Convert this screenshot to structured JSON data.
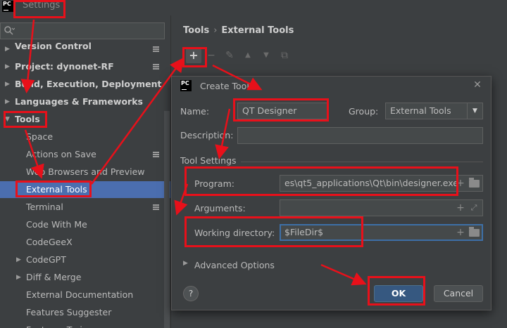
{
  "window": {
    "title": "Settings",
    "logo": "PC"
  },
  "search": {
    "placeholder": ""
  },
  "sidebar": {
    "items": [
      {
        "label": "Version Control"
      },
      {
        "label": "Project: dynonet-RF"
      },
      {
        "label": "Build, Execution, Deployment"
      },
      {
        "label": "Languages & Frameworks"
      },
      {
        "label": "Tools"
      },
      {
        "label": "Space"
      },
      {
        "label": "Actions on Save"
      },
      {
        "label": "Web Browsers and Preview"
      },
      {
        "label": "External Tools"
      },
      {
        "label": "Terminal"
      },
      {
        "label": "Code With Me"
      },
      {
        "label": "CodeGeeX"
      },
      {
        "label": "CodeGPT"
      },
      {
        "label": "Diff & Merge"
      },
      {
        "label": "External Documentation"
      },
      {
        "label": "Features Suggester"
      },
      {
        "label": "Features Trainer"
      }
    ]
  },
  "main": {
    "breadcrumb": {
      "root": "Tools",
      "separator": "›",
      "current": "External Tools"
    },
    "toolbar": {
      "add": "+",
      "remove": "−",
      "edit": "✎",
      "up": "▲",
      "down": "▼",
      "copy": "⧉"
    }
  },
  "dialog": {
    "title": "Create Tool",
    "name_label": "Name:",
    "name_value": "QT Designer",
    "group_label": "Group:",
    "group_value": "External Tools",
    "description_label": "Description:",
    "description_value": "",
    "section_title": "Tool Settings",
    "program_label": "Program:",
    "program_value": "es\\qt5_applications\\Qt\\bin\\designer.exe",
    "arguments_label": "Arguments:",
    "arguments_value": "",
    "workdir_label": "Working directory:",
    "workdir_value": "$FileDir$",
    "advanced_label": "Advanced Options",
    "help_label": "?",
    "ok_label": "OK",
    "cancel_label": "Cancel"
  },
  "colors": {
    "annotation": "#e8101a",
    "selection": "#4b6eaf",
    "focus": "#3d6fa7"
  }
}
